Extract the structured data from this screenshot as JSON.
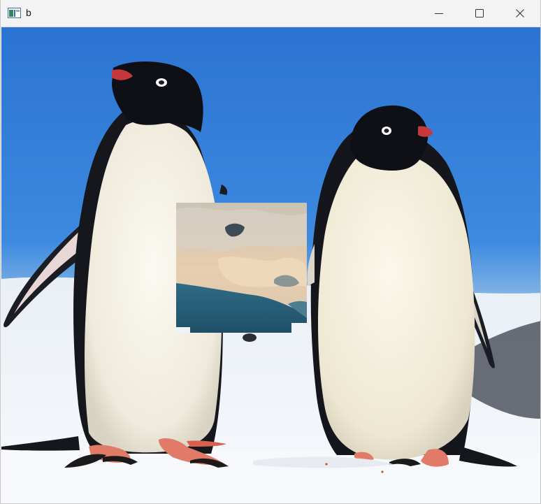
{
  "window": {
    "title": "b",
    "app_icon": "opencv-window-icon",
    "controls": [
      "minimize-icon",
      "maximize-icon",
      "close-icon"
    ]
  },
  "image": {
    "description_icon": "penguins-photo",
    "overlay_icon": "overlay-patch",
    "colors": {
      "sky": "#2f7ed8",
      "snow": "#eef3f8",
      "penguin_black": "#101218",
      "penguin_white": "#f4f1e6",
      "beak": "#d63a3a",
      "feet": "#e27a68",
      "overlay_sky": "#e7cdb0",
      "overlay_water": "#2f6b84"
    }
  }
}
